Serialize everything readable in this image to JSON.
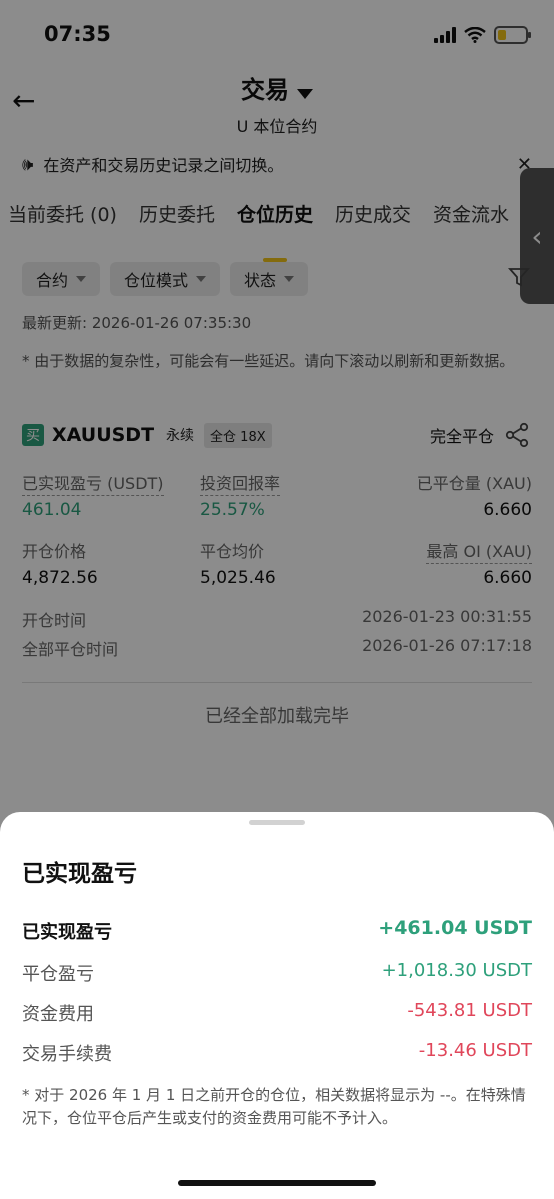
{
  "status_bar": {
    "time": "07:35"
  },
  "header": {
    "title": "交易",
    "subtitle": "U 本位合约"
  },
  "notice": {
    "text": "在资产和交易历史记录之间切换。"
  },
  "tabs": [
    {
      "label": "当前委托 (0)"
    },
    {
      "label": "历史委托"
    },
    {
      "label": "仓位历史",
      "active": true
    },
    {
      "label": "历史成交"
    },
    {
      "label": "资金流水"
    }
  ],
  "filters": [
    {
      "label": "合约"
    },
    {
      "label": "仓位模式"
    },
    {
      "label": "状态"
    }
  ],
  "updated": "最新更新: 2026-01-26 07:35:30",
  "delay_note": "* 由于数据的复杂性，可能会有一些延迟。请向下滚动以刷新和更新数据。",
  "position": {
    "side_badge": "买",
    "symbol": "XAUUSDT",
    "perp_tag": "永续",
    "margin_tag": "全仓 18X",
    "close_all_label": "完全平仓",
    "realized_pnl_label": "已实现盈亏 (USDT)",
    "realized_pnl_value": "461.04",
    "roi_label": "投资回报率",
    "roi_value": "25.57%",
    "closed_qty_label": "已平仓量 (XAU)",
    "closed_qty_value": "6.660",
    "entry_price_label": "开仓价格",
    "entry_price_value": "4,872.56",
    "avg_close_label": "平仓均价",
    "avg_close_value": "5,025.46",
    "max_oi_label": "最高 OI (XAU)",
    "max_oi_value": "6.660",
    "open_time_label": "开仓时间",
    "open_time_value": "2026-01-23 00:31:55",
    "close_time_label": "全部平仓时间",
    "close_time_value": "2026-01-26 07:17:18"
  },
  "loaded_text": "已经全部加载完毕",
  "sheet": {
    "title": "已实现盈亏",
    "rows": [
      {
        "label": "已实现盈亏",
        "value": "+461.04 USDT"
      },
      {
        "label": "平仓盈亏",
        "value": "+1,018.30 USDT"
      },
      {
        "label": "资金费用",
        "value": "-543.81 USDT"
      },
      {
        "label": "交易手续费",
        "value": "-13.46 USDT"
      }
    ],
    "note": "* 对于 2026 年 1 月 1 日之前开仓的仓位，相关数据将显示为 --。在特殊情况下，仓位平仓后产生或支付的资金费用可能不予计入。"
  },
  "colors": {
    "positive": "#2ea07b",
    "negative": "#e0465a",
    "accent": "#f0c419"
  }
}
